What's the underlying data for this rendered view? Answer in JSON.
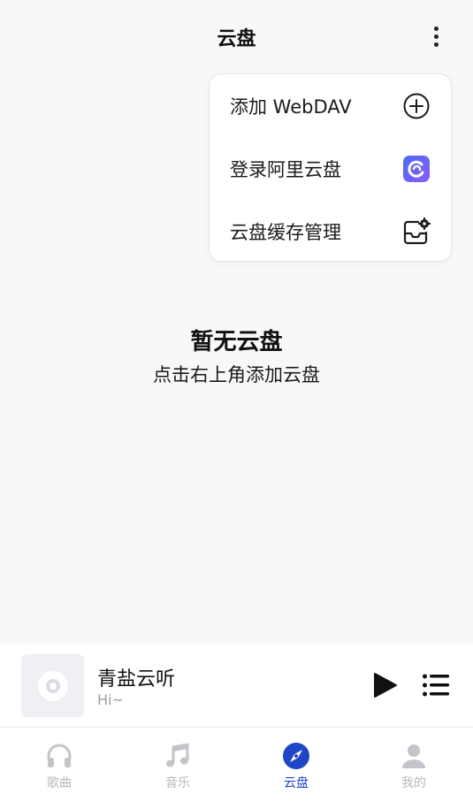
{
  "header": {
    "title": "云盘"
  },
  "menu": {
    "items": [
      {
        "label": "添加 WebDAV",
        "icon": "plus-circle-icon"
      },
      {
        "label": "登录阿里云盘",
        "icon": "aliyun-drive-icon"
      },
      {
        "label": "云盘缓存管理",
        "icon": "cache-settings-icon"
      }
    ]
  },
  "empty": {
    "title": "暂无云盘",
    "subtitle": "点击右上角添加云盘"
  },
  "player": {
    "title": "青盐云听",
    "subtitle": "Hi~"
  },
  "tabs": [
    {
      "label": "歌曲",
      "icon": "headphones-icon",
      "active": false
    },
    {
      "label": "音乐",
      "icon": "music-note-icon",
      "active": false
    },
    {
      "label": "云盘",
      "icon": "compass-icon",
      "active": true
    },
    {
      "label": "我的",
      "icon": "person-icon",
      "active": false
    }
  ],
  "colors": {
    "accent": "#1f46c8",
    "inactive": "#b7b9be",
    "background": "#f7f8fa"
  }
}
